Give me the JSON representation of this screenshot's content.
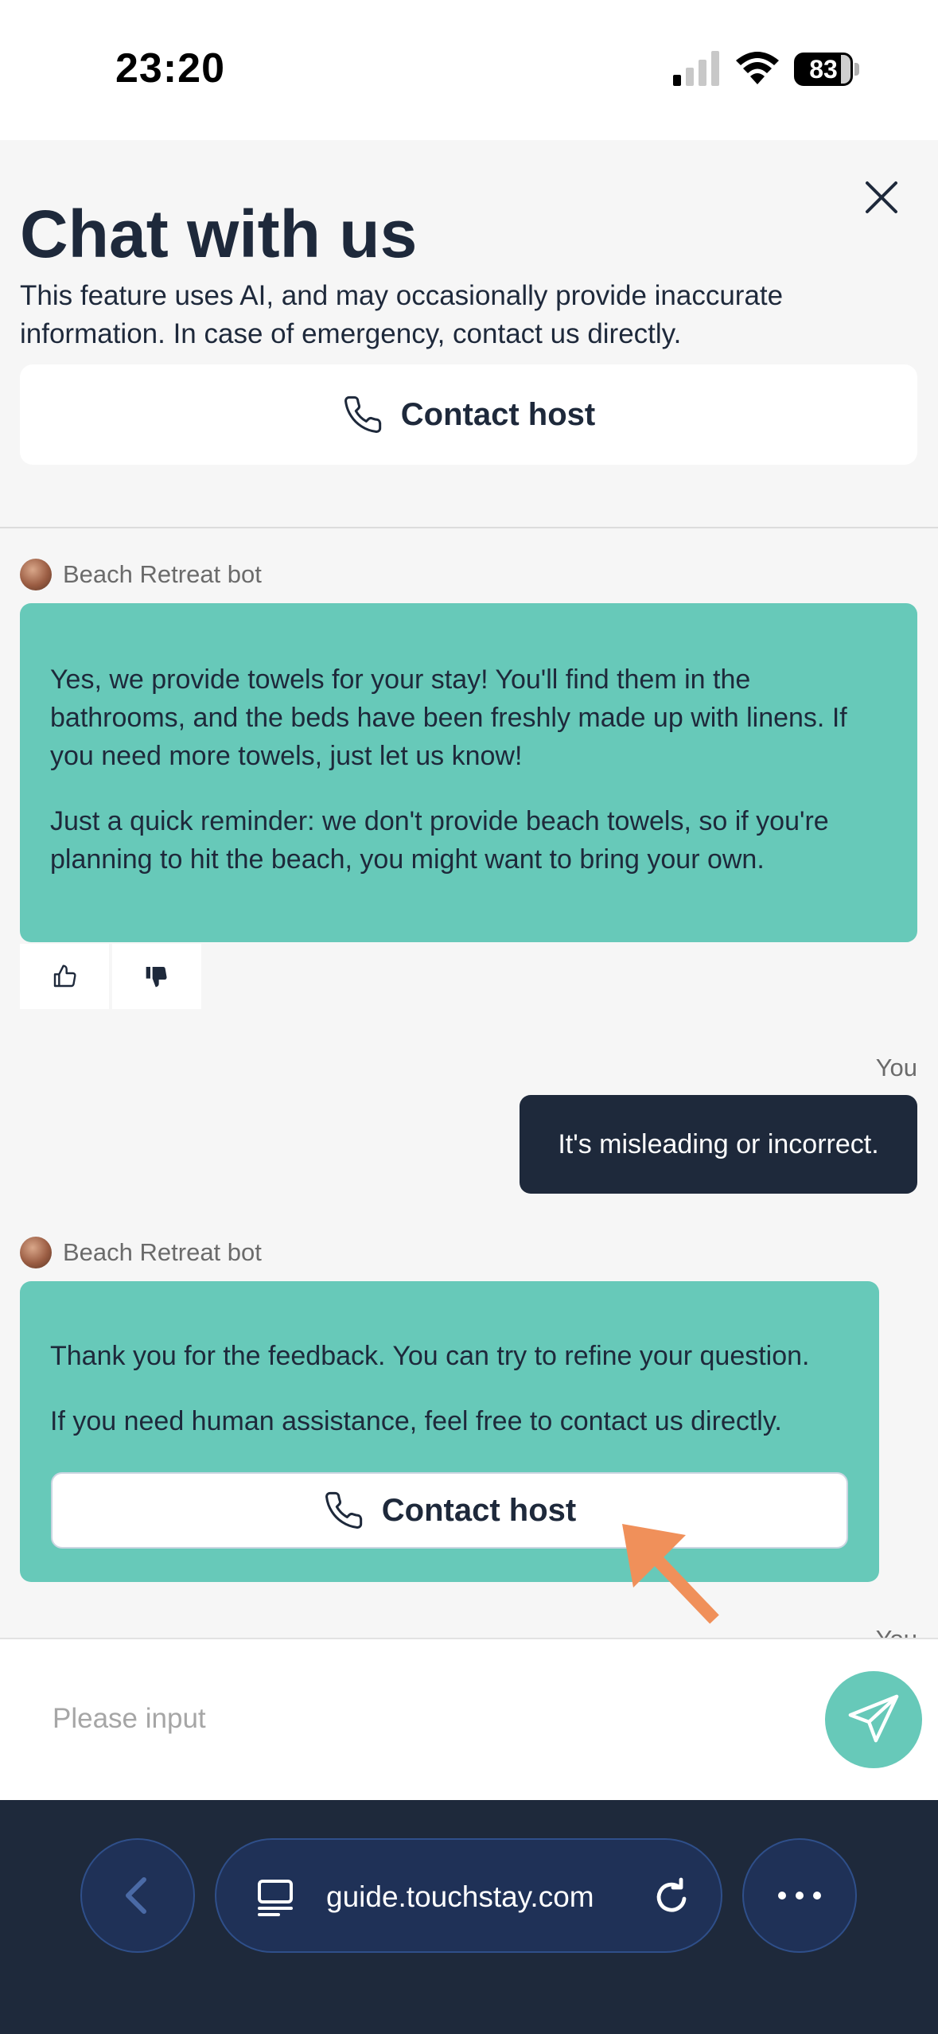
{
  "status_bar": {
    "time": "23:20",
    "battery": "83",
    "battery_level_percent": 83
  },
  "header": {
    "title": "Chat with us",
    "disclaimer": "This feature uses AI, and may occasionally provide inaccurate information. In case of emergency, contact us directly.",
    "contact_button": "Contact host"
  },
  "chat": {
    "messages": [
      {
        "sender": "Beach Retreat bot",
        "paragraphs": [
          "Yes, we provide towels for your stay! You'll find them in the bathrooms, and the beds have been freshly made up with linens. If you need more towels, just let us know!",
          "Just a quick reminder: we don't provide beach towels, so if you're planning to hit the beach, you might want to bring your own."
        ]
      },
      {
        "sender": "You",
        "text": "It's misleading or incorrect."
      },
      {
        "sender": "Beach Retreat bot",
        "paragraphs": [
          "Thank you for the feedback. You can try to refine your question.",
          "If you need human assistance, feel free to contact us directly."
        ],
        "button": "Contact host"
      }
    ],
    "partial_label": "You"
  },
  "input": {
    "placeholder": "Please input"
  },
  "browser": {
    "url": "guide.touchstay.com"
  },
  "colors": {
    "bot_bubble": "#67c9b9",
    "user_bubble": "#1e293b",
    "browser_bar": "#1e293b",
    "annotation_arrow": "#f0905a"
  }
}
